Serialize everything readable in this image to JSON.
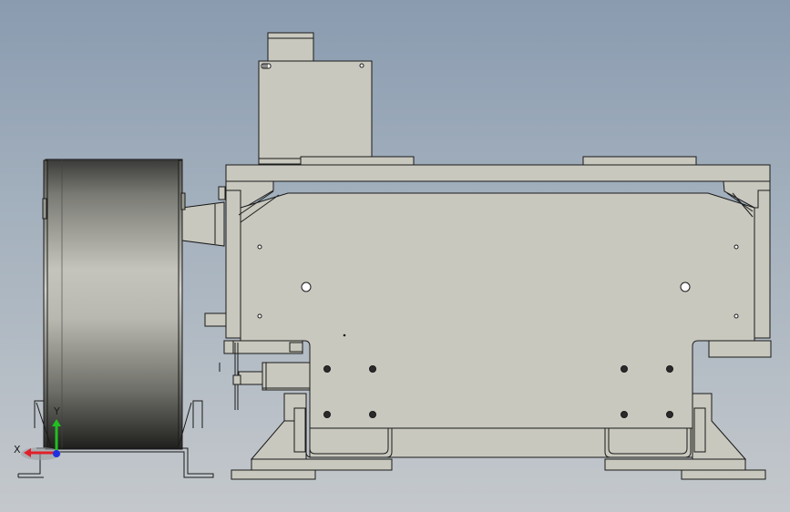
{
  "view": {
    "background_top": "#8a9bb0",
    "background_bottom": "#c4c8cc",
    "part_fill": "#c8c8be",
    "part_stroke": "#1a1a1a"
  },
  "triad": {
    "x_label": "X",
    "y_label": "Y",
    "x_color": "#e0202a",
    "y_color": "#20c020",
    "z_color": "#2030e0"
  }
}
